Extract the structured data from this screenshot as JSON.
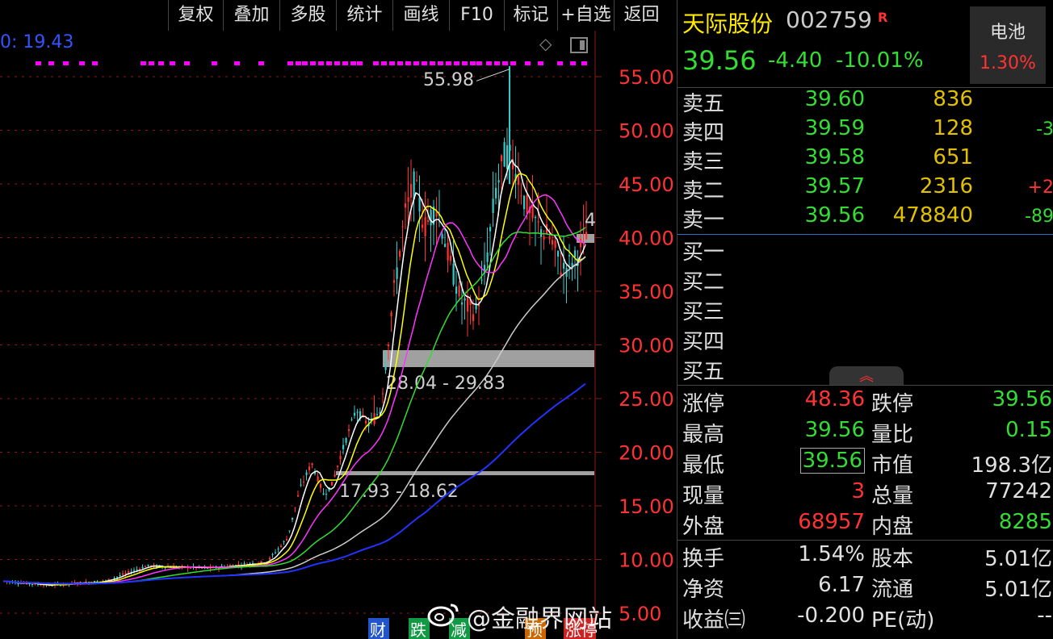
{
  "toolbar": {
    "buttons": [
      "复权",
      "叠加",
      "多股",
      "统计",
      "画线",
      "F10",
      "标记",
      "+自选",
      "返回"
    ]
  },
  "chart": {
    "ma_label": "0: 19.43",
    "peak_label": "55.98",
    "side_label": "4",
    "zone1_label": "28.04 - 29.83",
    "zone2_label": "17.93 - 18.62",
    "events": [
      "财",
      "跌",
      "减",
      "预",
      "涨停"
    ],
    "colors": {
      "up": "#ff3333",
      "down": "#33cccc",
      "ma5": "#ffffff",
      "ma10": "#ffff00",
      "ma20": "#ff33ff",
      "ma30": "#33dd33",
      "ma60": "#cccccc",
      "ma120": "#2233ff",
      "grid": "#8a1a1a"
    }
  },
  "chart_data": {
    "type": "candlestick",
    "y_ticks": [
      "55.00",
      "50.00",
      "45.00",
      "40.00",
      "35.00",
      "30.00",
      "25.00",
      "20.00",
      "15.00",
      "10.00",
      "5.00"
    ],
    "ylim": [
      5,
      58
    ],
    "highlight_zones": [
      [
        28.04,
        29.83
      ],
      [
        17.93,
        18.62
      ]
    ],
    "peak": 55.98
  },
  "quote": {
    "name": "天际股份",
    "code": "002759",
    "badge": "R",
    "price": "39.56",
    "change": "-4.40",
    "change_pct": "-10.01%",
    "sector": "电池",
    "sector_pct": "1.30%"
  },
  "orderbook": {
    "sell": [
      {
        "label": "卖五",
        "price": "39.60",
        "vol": "836",
        "chg": ""
      },
      {
        "label": "卖四",
        "price": "39.59",
        "vol": "128",
        "chg": "-3"
      },
      {
        "label": "卖三",
        "price": "39.58",
        "vol": "651",
        "chg": ""
      },
      {
        "label": "卖二",
        "price": "39.57",
        "vol": "2316",
        "chg": "+2"
      },
      {
        "label": "卖一",
        "price": "39.56",
        "vol": "478840",
        "chg": "-89"
      }
    ],
    "buy": [
      "买一",
      "买二",
      "买三",
      "买四",
      "买五"
    ]
  },
  "stats": [
    {
      "l1": "涨停",
      "v1": "48.36",
      "c1": "red",
      "l2": "跌停",
      "v2": "39.56",
      "c2": "green"
    },
    {
      "l1": "最高",
      "v1": "39.56",
      "c1": "green",
      "l2": "量比",
      "v2": "0.15",
      "c2": "green"
    },
    {
      "l1": "最低",
      "v1": "39.56",
      "c1": "green boxed",
      "l2": "市值",
      "v2": "198.3亿",
      "c2": "white"
    },
    {
      "l1": "现量",
      "v1": "3",
      "c1": "red",
      "l2": "总量",
      "v2": "77242",
      "c2": "white"
    },
    {
      "l1": "外盘",
      "v1": "68957",
      "c1": "red",
      "l2": "内盘",
      "v2": "8285",
      "c2": "green"
    },
    {
      "l1": "换手",
      "v1": "1.54%",
      "c1": "white",
      "l2": "股本",
      "v2": "5.01亿",
      "c2": "white"
    },
    {
      "l1": "净资",
      "v1": "6.17",
      "c1": "white",
      "l2": "流通",
      "v2": "5.01亿",
      "c2": "white"
    },
    {
      "l1": "收益㈢",
      "v1": "-0.200",
      "c1": "white",
      "l2": "PE(动)",
      "v2": "--",
      "c2": "white"
    }
  ],
  "watermark": "@金融界网站"
}
